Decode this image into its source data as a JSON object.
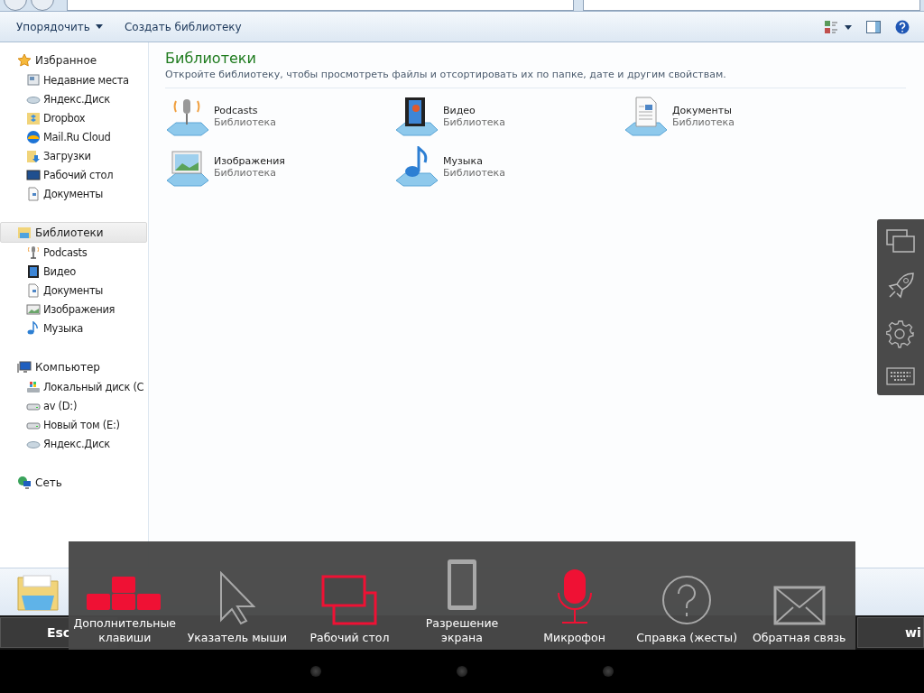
{
  "toolbar": {
    "buttons": [
      {
        "label": "Упорядочить",
        "dropdown": true
      },
      {
        "label": "Создать библиотеку",
        "dropdown": false
      }
    ]
  },
  "sidebar": {
    "groups": [
      {
        "label": "Избранное",
        "kind": "star",
        "selected": false,
        "children": [
          {
            "label": "Недавние места",
            "kind": "recent"
          },
          {
            "label": "Яндекс.Диск",
            "kind": "ydisk"
          },
          {
            "label": "Dropbox",
            "kind": "dropbox"
          },
          {
            "label": "Mail.Ru Cloud",
            "kind": "cloud"
          },
          {
            "label": "Загрузки",
            "kind": "downloads"
          },
          {
            "label": "Рабочий стол",
            "kind": "desktop"
          },
          {
            "label": "Документы",
            "kind": "doc"
          }
        ]
      },
      {
        "label": "Библиотеки",
        "kind": "library",
        "selected": true,
        "children": [
          {
            "label": "Podcasts",
            "kind": "mic"
          },
          {
            "label": "Видео",
            "kind": "film"
          },
          {
            "label": "Документы",
            "kind": "doc"
          },
          {
            "label": "Изображения",
            "kind": "image"
          },
          {
            "label": "Музыка",
            "kind": "note"
          }
        ]
      },
      {
        "label": "Компьютер",
        "kind": "computer",
        "selected": false,
        "children": [
          {
            "label": "Локальный диск (C",
            "kind": "sysdrive"
          },
          {
            "label": "av (D:)",
            "kind": "drive"
          },
          {
            "label": "Новый том (E:)",
            "kind": "drive"
          },
          {
            "label": "Яндекс.Диск",
            "kind": "ydisk"
          }
        ]
      },
      {
        "label": "Сеть",
        "kind": "network",
        "selected": false
      }
    ]
  },
  "content": {
    "title": "Библиотеки",
    "subtitle": "Откройте библиотеку, чтобы просмотреть файлы и отсортировать их по папке, дате и другим свойствам.",
    "libraries": [
      {
        "name": "Podcasts",
        "type": "Библиотека",
        "kind": "mic"
      },
      {
        "name": "Видео",
        "type": "Библиотека",
        "kind": "film"
      },
      {
        "name": "Документы",
        "type": "Библиотека",
        "kind": "doc"
      },
      {
        "name": "Изображения",
        "type": "Библиотека",
        "kind": "image"
      },
      {
        "name": "Музыка",
        "type": "Библиотека",
        "kind": "note"
      }
    ]
  },
  "keys": [
    {
      "label": "Esc"
    },
    {
      "label": "wi"
    }
  ],
  "overlay": {
    "items": [
      {
        "label": "Дополнительные\nклавиши",
        "kind": "keys",
        "active": true
      },
      {
        "label": "Указатель мыши",
        "kind": "pointer",
        "active": false
      },
      {
        "label": "Рабочий стол",
        "kind": "desktop",
        "active": true
      },
      {
        "label": "Разрешение\nэкрана",
        "kind": "phone",
        "active": false
      },
      {
        "label": "Микрофон",
        "kind": "mic",
        "active": true
      },
      {
        "label": "Справка (жесты)",
        "kind": "help",
        "active": false
      },
      {
        "label": "Обратная связь",
        "kind": "mail",
        "active": false
      }
    ]
  }
}
